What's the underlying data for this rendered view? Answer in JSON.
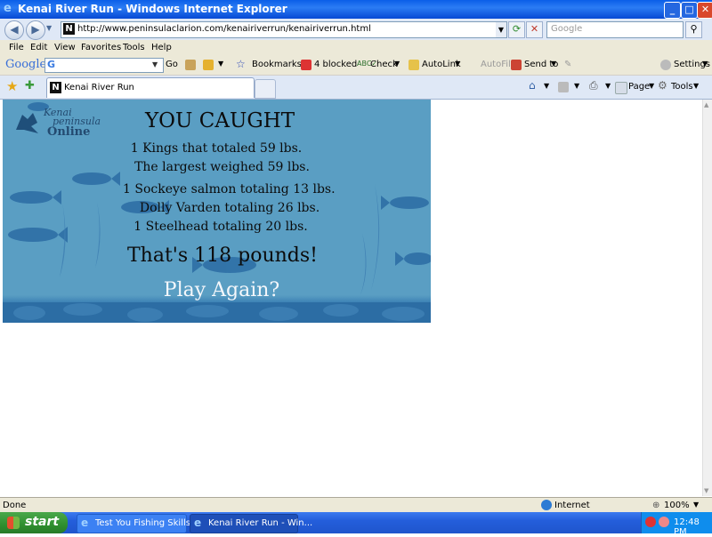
{
  "window": {
    "title": "Kenai River Run - Windows Internet Explorer"
  },
  "address": {
    "url": "http://www.peninsulaclarion.com/kenairiverrun/kenairiverrun.html",
    "search_placeholder": "Google"
  },
  "menu": [
    "File",
    "Edit",
    "View",
    "Favorites",
    "Tools",
    "Help"
  ],
  "google_toolbar": {
    "logo": "Google",
    "search_prefix": "G",
    "go": "Go",
    "bookmarks": "Bookmarks",
    "blocked": "4 blocked",
    "check": "Check",
    "autolink": "AutoLink",
    "autofill": "AutoFill",
    "send_to": "Send to",
    "settings": "Settings"
  },
  "tabs": [
    {
      "label": "Kenai River Run"
    }
  ],
  "tab_tools": {
    "page": "Page",
    "tools": "Tools"
  },
  "game": {
    "logo_line1": "Kenai",
    "logo_line2": "peninsula",
    "logo_line3": "Online",
    "heading": "YOU CAUGHT",
    "line1": "1 Kings that totaled 59 lbs.",
    "line2": "The largest weighed 59 lbs.",
    "line3": "1 Sockeye salmon totaling 13 lbs.",
    "line4": "Dolly Varden totaling 26 lbs.",
    "line5": "1 Steelhead totaling 20 lbs.",
    "total": "That's 118 pounds!",
    "play_again": "Play Again?"
  },
  "status": {
    "text": "Done",
    "zone": "Internet",
    "zoom": "100%"
  },
  "taskbar": {
    "start": "start",
    "items": [
      "Test You Fishing Skills...",
      "Kenai River Run - Win..."
    ],
    "clock": "12:48 PM"
  },
  "colors": {
    "game_bg": "#5a9ec3",
    "fish": "#2e6fa6"
  }
}
